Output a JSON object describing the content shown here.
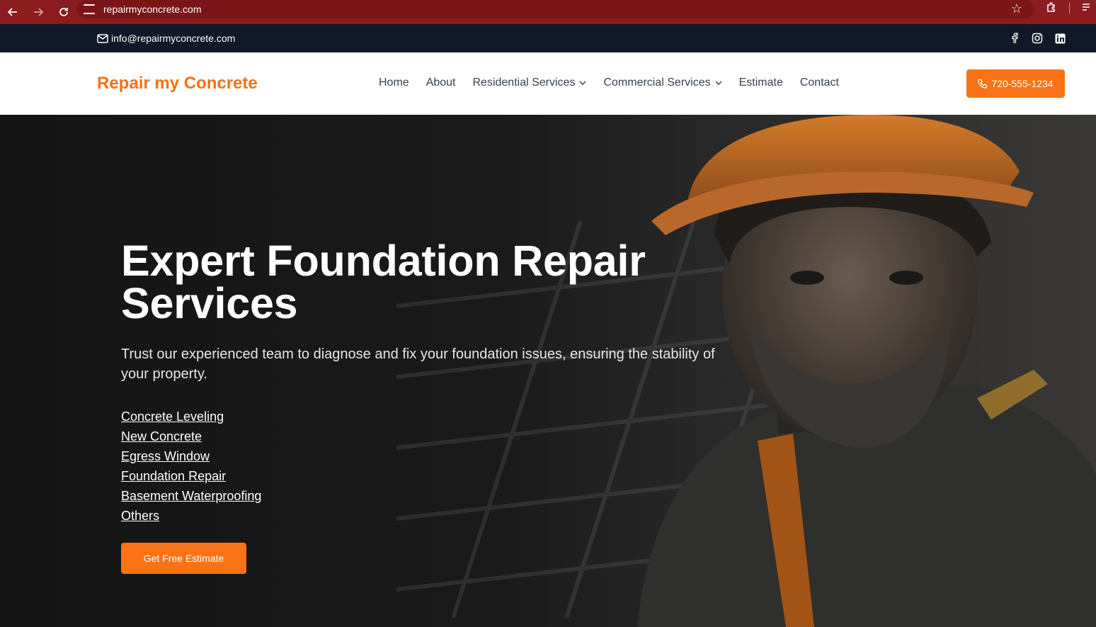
{
  "browser": {
    "url": "repairmyconcrete.com"
  },
  "topbar": {
    "email": "info@repairmyconcrete.com",
    "social_icons": [
      "facebook-icon",
      "instagram-icon",
      "linkedin-icon"
    ]
  },
  "header": {
    "logo": "Repair my Concrete",
    "nav": [
      {
        "label": "Home",
        "dropdown": false
      },
      {
        "label": "About",
        "dropdown": false
      },
      {
        "label": "Residential Services",
        "dropdown": true
      },
      {
        "label": "Commercial Services",
        "dropdown": true
      },
      {
        "label": "Estimate",
        "dropdown": false
      },
      {
        "label": "Contact",
        "dropdown": false
      }
    ],
    "phone": "720-555-1234"
  },
  "hero": {
    "title": "Expert Foundation Repair Services",
    "subtitle": "Trust our experienced team to diagnose and fix your foundation issues, ensuring the stability of your property.",
    "services": [
      "Concrete Leveling",
      "New Concrete",
      "Egress Window",
      "Foundation Repair",
      "Basement Waterproofing",
      "Others"
    ],
    "cta": "Get Free Estimate"
  },
  "colors": {
    "accent": "#f97316",
    "logo": "#f47216",
    "topbar": "#111827",
    "browser_chrome": "#8b1c1f"
  }
}
